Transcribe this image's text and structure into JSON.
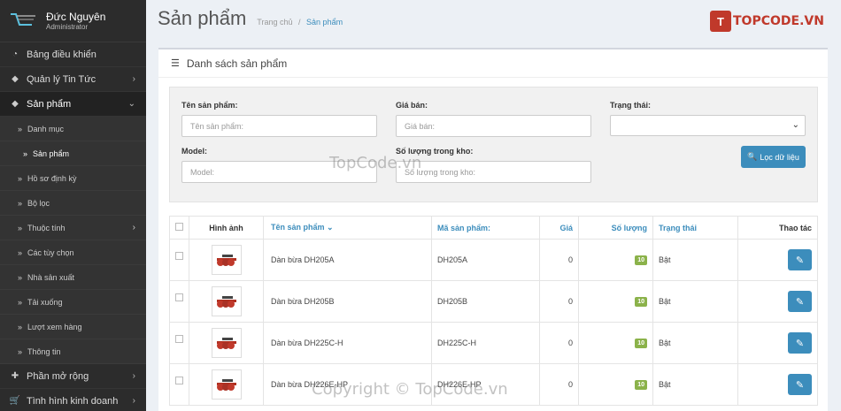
{
  "user": {
    "name": "Đức Nguyên",
    "role": "Administrator"
  },
  "menu": [
    {
      "label": "Bảng điều khiển",
      "icon": "dashboard-icon"
    },
    {
      "label": "Quản lý Tin Tức",
      "icon": "tag-icon",
      "chevron": "›"
    },
    {
      "label": "Sản phẩm",
      "icon": "tag-icon",
      "chevron": "⌄"
    }
  ],
  "submenu": [
    {
      "label": "Danh mục"
    },
    {
      "label": "Sản phẩm"
    },
    {
      "label": "Hồ sơ định kỳ"
    },
    {
      "label": "Bộ lọc"
    },
    {
      "label": "Thuộc tính",
      "chevron": "›"
    },
    {
      "label": "Các tùy chọn"
    },
    {
      "label": "Nhà sản xuất"
    },
    {
      "label": "Tải xuống"
    },
    {
      "label": "Lượt xem hàng"
    },
    {
      "label": "Thông tin"
    }
  ],
  "menu_bottom": [
    {
      "label": "Phần mở rộng",
      "icon": "puzzle-icon",
      "chevron": "›"
    },
    {
      "label": "Tình hình kinh doanh",
      "icon": "cart-icon",
      "chevron": "›"
    }
  ],
  "header": {
    "title": "Sản phẩm",
    "breadcrumb_home": "Trang chủ",
    "breadcrumb_sep": "/",
    "breadcrumb_current": "Sản phẩm"
  },
  "logo": {
    "text": "TOPCODE",
    "suffix": ".VN",
    "mark": "T"
  },
  "panel": {
    "title": "Danh sách sản phẩm"
  },
  "filter": {
    "name_label": "Tên sản phẩm:",
    "name_placeholder": "Tên sản phẩm:",
    "price_label": "Giá bán:",
    "price_placeholder": "Giá bán:",
    "status_label": "Trạng thái:",
    "model_label": "Model:",
    "model_placeholder": "Model:",
    "stock_label": "Số lượng trong kho:",
    "stock_placeholder": "Số lượng trong kho:",
    "button": "Lọc dữ liệu"
  },
  "table": {
    "headers": {
      "image": "Hình ảnh",
      "name": "Tên sản phẩm",
      "sku": "Mã sản phẩm:",
      "price": "Giá",
      "qty": "Số lượng",
      "status": "Trạng thái",
      "actions": "Thao tác"
    },
    "rows": [
      {
        "name": "Dàn bừa DH205A",
        "sku": "DH205A",
        "price": "0",
        "qty": "10",
        "status": "Bật"
      },
      {
        "name": "Dàn bừa DH205B",
        "sku": "DH205B",
        "price": "0",
        "qty": "10",
        "status": "Bật"
      },
      {
        "name": "Dàn bừa DH225C-H",
        "sku": "DH225C-H",
        "price": "0",
        "qty": "10",
        "status": "Bật"
      },
      {
        "name": "Dàn bừa DH226E-HP",
        "sku": "DH226E-HP",
        "price": "0",
        "qty": "10",
        "status": "Bật"
      }
    ]
  },
  "watermarks": {
    "top": "TopCode.vn",
    "bottom": "Copyright © TopCode.vn"
  },
  "colors": {
    "accent": "#3c8dbc",
    "sidebar": "#2c2c2c",
    "qty_badge": "#8bb24a",
    "logo_red": "#c0392b"
  }
}
